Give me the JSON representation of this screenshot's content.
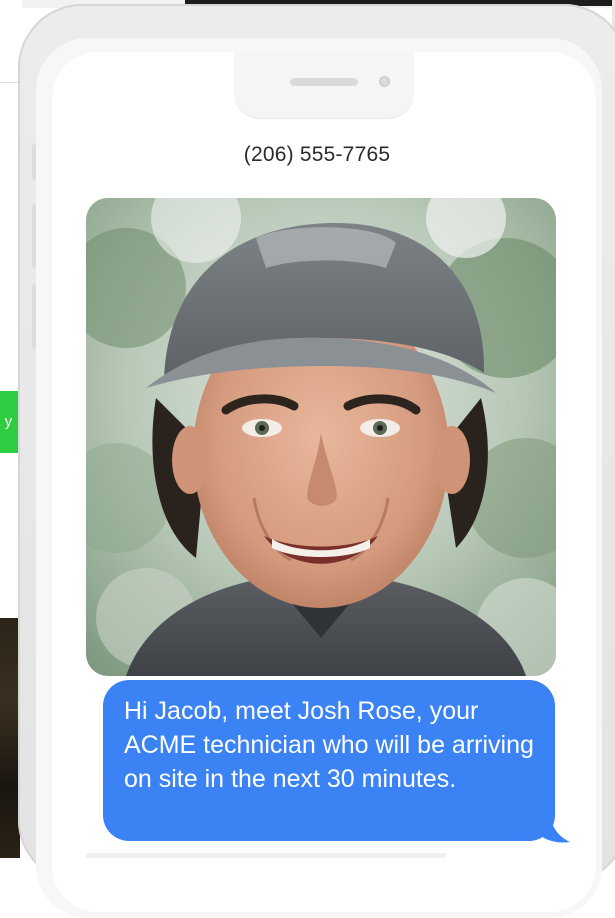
{
  "background": {
    "cta_fragment": "k y",
    "accent_green": "#2ecc40"
  },
  "conversation": {
    "contact_number": "(206) 555-7765",
    "photo_message": {
      "icon": "technician-photo"
    },
    "text_message": {
      "body": "Hi Jacob, meet Josh Rose, your ACME technician who will be arriving on site in the next 30 minutes.",
      "bubble_color": "#3b82f5"
    }
  }
}
